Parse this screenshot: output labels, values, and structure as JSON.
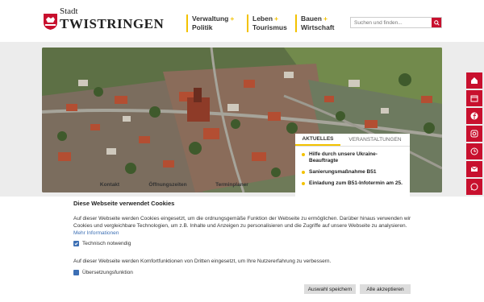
{
  "logo": {
    "small": "Stadt",
    "big": "TWISTRINGEN"
  },
  "nav": [
    {
      "line1": "Verwaltung",
      "line2": "Politik"
    },
    {
      "line1": "Leben",
      "line2": "Tourismus"
    },
    {
      "line1": "Bauen",
      "line2": "Wirtschaft"
    }
  ],
  "nav_plus": "+",
  "search": {
    "placeholder": "Suchen und finden..."
  },
  "quick_links": [
    "Kontakt",
    "Öffnungszeiten",
    "Terminplaner"
  ],
  "news": {
    "tabs": [
      "AKTUELLES",
      "VERANSTALTUNGEN"
    ],
    "items": [
      "Hilfe durch unsere Ukraine-Beauftragte",
      "Sanierungsmaßnahme B51",
      "Einladung zum B51-Infotermin am 25."
    ]
  },
  "social_icons": [
    "home-icon",
    "calendar-icon",
    "facebook-icon",
    "instagram-icon",
    "clock-icon",
    "mail-icon",
    "whatsapp-icon",
    "accessibility-icon"
  ],
  "colors": {
    "accent": "#c8102e",
    "yellow": "#f3c200",
    "checkbox": "#3c6fb4"
  },
  "cookie": {
    "title": "Diese Webseite verwendet Cookies",
    "text1": "Auf dieser Webseite werden Cookies eingesetzt, um die ordnungsgemäße Funktion der Webseite zu ermöglichen. Darüber hinaus verwenden wir Cookies und vergleichbare Technologien, um z.B. Inhalte und Anzeigen zu personalisieren und die Zugriffe auf unsere Webseite zu analysieren.",
    "more_link": "Mehr Informationen",
    "option1": "Technisch notwendig",
    "text2": "Auf dieser Webseite werden Komfortfunktionen von Dritten eingesetzt, um Ihre Nutzererfahrung zu verbessern.",
    "option2": "Übersetzungsfunktion",
    "btn_save": "Auswahl speichern",
    "btn_accept": "Alle akzeptieren"
  }
}
